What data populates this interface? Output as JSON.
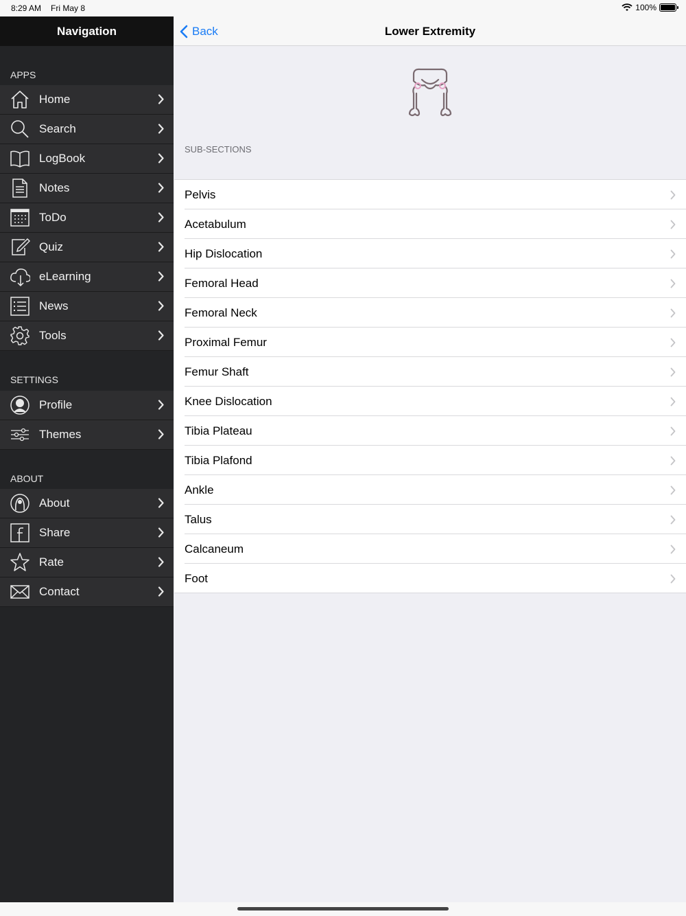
{
  "status": {
    "time": "8:29 AM",
    "date": "Fri May 8",
    "battery": "100%"
  },
  "sidebar": {
    "title": "Navigation",
    "sections": [
      {
        "label": "APPS",
        "items": [
          {
            "label": "Home",
            "icon": "home-icon"
          },
          {
            "label": "Search",
            "icon": "search-icon"
          },
          {
            "label": "LogBook",
            "icon": "book-icon"
          },
          {
            "label": "Notes",
            "icon": "notes-icon"
          },
          {
            "label": "ToDo",
            "icon": "calendar-icon"
          },
          {
            "label": "Quiz",
            "icon": "edit-icon"
          },
          {
            "label": "eLearning",
            "icon": "cloud-download-icon"
          },
          {
            "label": "News",
            "icon": "list-icon"
          },
          {
            "label": "Tools",
            "icon": "gear-icon"
          }
        ]
      },
      {
        "label": "SETTINGS",
        "items": [
          {
            "label": "Profile",
            "icon": "profile-icon"
          },
          {
            "label": "Themes",
            "icon": "sliders-icon"
          }
        ]
      },
      {
        "label": "ABOUT",
        "items": [
          {
            "label": "About",
            "icon": "about-icon"
          },
          {
            "label": "Share",
            "icon": "facebook-icon"
          },
          {
            "label": "Rate",
            "icon": "star-icon"
          },
          {
            "label": "Contact",
            "icon": "mail-icon"
          }
        ]
      }
    ]
  },
  "main": {
    "back_label": "Back",
    "title": "Lower Extremity",
    "hero_icon": "pelvis-skeleton-icon",
    "sub_header": "SUB-SECTIONS",
    "rows": [
      "Pelvis",
      "Acetabulum",
      "Hip Dislocation",
      "Femoral Head",
      "Femoral Neck",
      "Proximal Femur",
      "Femur Shaft",
      "Knee Dislocation",
      "Tibia Plateau",
      "Tibia Plafond",
      "Ankle",
      "Talus",
      "Calcaneum",
      "Foot"
    ]
  },
  "colors": {
    "accent": "#1a7cf5",
    "sidebar_bg": "#232426",
    "sidebar_item_bg": "#2e2e30"
  }
}
